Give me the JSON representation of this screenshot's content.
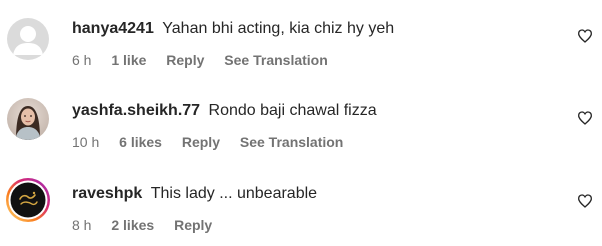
{
  "comments": [
    {
      "username": "hanya4241",
      "text": "Yahan bhi acting, kia chiz hy yeh",
      "time": "6 h",
      "likes": "1 like",
      "reply": "Reply",
      "translation": "See Translation",
      "avatar": "default-avatar-icon"
    },
    {
      "username": "yashfa.sheikh.77",
      "text": "Rondo baji chawal fizza",
      "time": "10 h",
      "likes": "6 likes",
      "reply": "Reply",
      "translation": "See Translation",
      "avatar": "profile-photo"
    },
    {
      "username": "raveshpk",
      "text": "This lady ... unbearable",
      "time": "8 h",
      "likes": "2 likes",
      "reply": "Reply",
      "avatar": "story-ring-logo"
    }
  ],
  "colors": {
    "text": "#262626",
    "secondary": "#737373",
    "default_avatar_bg": "#dbdbdb",
    "default_avatar_fg": "#ffffff"
  }
}
